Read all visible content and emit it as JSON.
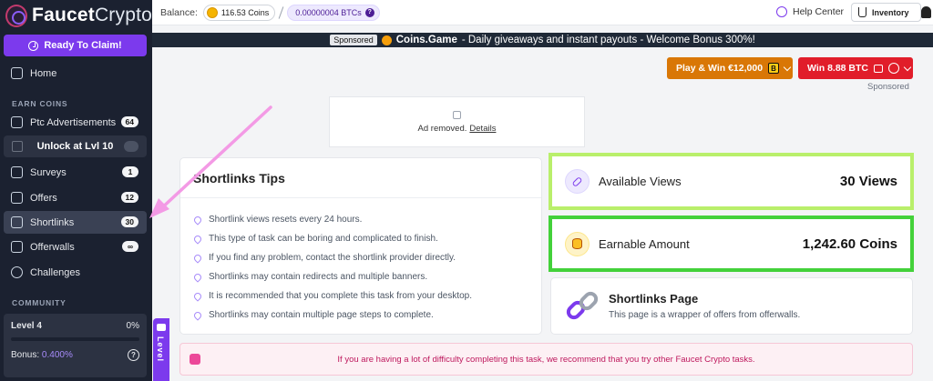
{
  "brand": {
    "name_part1": "Faucet",
    "name_part2": "Crypto"
  },
  "sidebar": {
    "claim_label": "Ready To Claim!",
    "home_label": "Home",
    "earn_section": "EARN COINS",
    "items": [
      {
        "label": "Ptc Advertisements",
        "badge": "64"
      },
      {
        "label": "Surveys",
        "badge": "1"
      },
      {
        "label": "Offers",
        "badge": "12"
      },
      {
        "label": "Shortlinks",
        "badge": "30"
      },
      {
        "label": "Offerwalls",
        "badge": "∞"
      },
      {
        "label": "Challenges",
        "badge": ""
      }
    ],
    "locked_label": "Unlock at Lvl 10",
    "community_section": "COMMUNITY",
    "level": {
      "label": "Level 4",
      "progress_text": "0%",
      "progress": 0.0,
      "bonus_label": "Bonus:",
      "bonus_value": "0.400%"
    }
  },
  "topbar": {
    "balance_label": "Balance:",
    "coins": "116.53 Coins",
    "btc": "0.00000004 BTCs",
    "help": "Help Center",
    "inventory": "Inventory"
  },
  "banner": {
    "tag": "Sponsored",
    "brand": "Coins.Game",
    "text": "- Daily giveaways and instant payouts - Welcome Bonus 300%!"
  },
  "promos": {
    "play": "Play & Win €12,000",
    "win": "Win 8.88 BTC",
    "sponsored": "Sponsored"
  },
  "ad": {
    "text": "Ad removed.",
    "link": "Details"
  },
  "tips": {
    "title": "Shortlinks Tips",
    "items": [
      "Shortlink views resets every 24 hours.",
      "This type of task can be boring and complicated to finish.",
      "If you find any problem, contact the shortlink provider directly.",
      "Shortlinks may contain redirects and multiple banners.",
      "It is recommended that you complete this task from your desktop.",
      "Shortlinks may contain multiple page steps to complete."
    ]
  },
  "stats": {
    "views_label": "Available Views",
    "views_value": "30 Views",
    "earn_label": "Earnable Amount",
    "earn_value": "1,242.60 Coins"
  },
  "page_card": {
    "title": "Shortlinks Page",
    "subtitle": "This page is a wrapper of offers from offerwalls."
  },
  "warning": "If you are having a lot of difficulty completing this task, we recommend that you try other Faucet Crypto tasks.",
  "level_tab": "Level"
}
